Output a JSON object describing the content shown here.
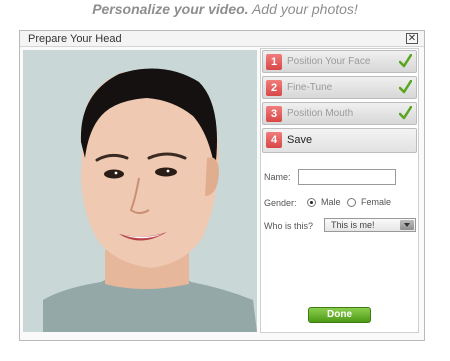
{
  "banner": {
    "bold_text": "Personalize your video.",
    "rest_text": "Add your photos!"
  },
  "dialog": {
    "title": "Prepare Your Head",
    "close_symbol": "✕"
  },
  "steps": [
    {
      "number": "1",
      "label": "Position Your Face",
      "done": true
    },
    {
      "number": "2",
      "label": "Fine-Tune",
      "done": true
    },
    {
      "number": "3",
      "label": "Position Mouth",
      "done": true
    },
    {
      "number": "4",
      "label": "Save",
      "done": false,
      "active": true
    }
  ],
  "form": {
    "name_label": "Name:",
    "name_value": "",
    "gender_label": "Gender:",
    "gender_options": [
      "Male",
      "Female"
    ],
    "gender_selected": "Male",
    "who_label": "Who is this?",
    "who_value": "This is me!",
    "done_label": "Done"
  },
  "colors": {
    "step_number_bg": "#e05555",
    "check": "#5aa51f",
    "done_button": "#5ea522",
    "photo_bg": "#c9d7d7"
  },
  "icons": {
    "close": "close-icon",
    "check": "check-icon",
    "dropdown": "chevron-down-icon"
  }
}
